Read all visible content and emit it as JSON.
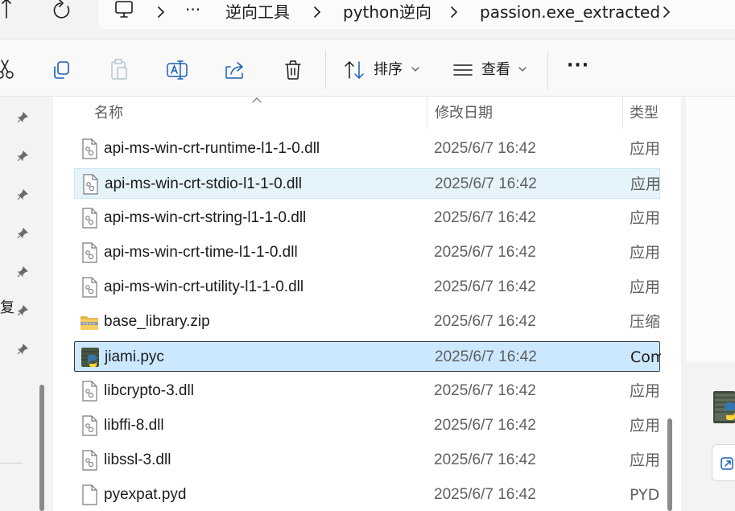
{
  "breadcrumb": {
    "overflow": "···",
    "items": [
      {
        "label": "逆向工具"
      },
      {
        "label": "python逆向"
      },
      {
        "label": "passion.exe_extracted"
      }
    ]
  },
  "toolbar": {
    "sort_label": "排序",
    "view_label": "查看",
    "more_label": "···"
  },
  "nav": {
    "partial_label": "复"
  },
  "columns": {
    "name": "名称",
    "modified": "修改日期",
    "type": "类型"
  },
  "files": [
    {
      "name": "api-ms-win-crt-runtime-l1-1-0.dll",
      "modified": "2025/6/7 16:42",
      "type": "应用程序扩展",
      "icon": "dll-file-icon"
    },
    {
      "name": "api-ms-win-crt-stdio-l1-1-0.dll",
      "modified": "2025/6/7 16:42",
      "type": "应用程序扩展",
      "icon": "dll-file-icon",
      "state": "hover"
    },
    {
      "name": "api-ms-win-crt-string-l1-1-0.dll",
      "modified": "2025/6/7 16:42",
      "type": "应用程序扩展",
      "icon": "dll-file-icon"
    },
    {
      "name": "api-ms-win-crt-time-l1-1-0.dll",
      "modified": "2025/6/7 16:42",
      "type": "应用程序扩展",
      "icon": "dll-file-icon"
    },
    {
      "name": "api-ms-win-crt-utility-l1-1-0.dll",
      "modified": "2025/6/7 16:42",
      "type": "应用程序扩展",
      "icon": "dll-file-icon"
    },
    {
      "name": "base_library.zip",
      "modified": "2025/6/7 16:42",
      "type": "压缩文件",
      "icon": "zip-folder-icon"
    },
    {
      "name": "jiami.pyc",
      "modified": "2025/6/7 16:42",
      "type": "Compiled Python File",
      "icon": "python-compiled-file-icon",
      "state": "selected"
    },
    {
      "name": "libcrypto-3.dll",
      "modified": "2025/6/7 16:42",
      "type": "应用程序扩展",
      "icon": "dll-file-icon"
    },
    {
      "name": "libffi-8.dll",
      "modified": "2025/6/7 16:42",
      "type": "应用程序扩展",
      "icon": "dll-file-icon"
    },
    {
      "name": "libssl-3.dll",
      "modified": "2025/6/7 16:42",
      "type": "应用程序扩展",
      "icon": "dll-file-icon"
    },
    {
      "name": "pyexpat.pyd",
      "modified": "2025/6/7 16:42",
      "type": "PYD 文件",
      "icon": "generic-file-icon"
    }
  ],
  "colors": {
    "hover_row": "#e5f3fb",
    "selected_row": "#cce8ff",
    "selected_border": "#3b3b3b"
  }
}
